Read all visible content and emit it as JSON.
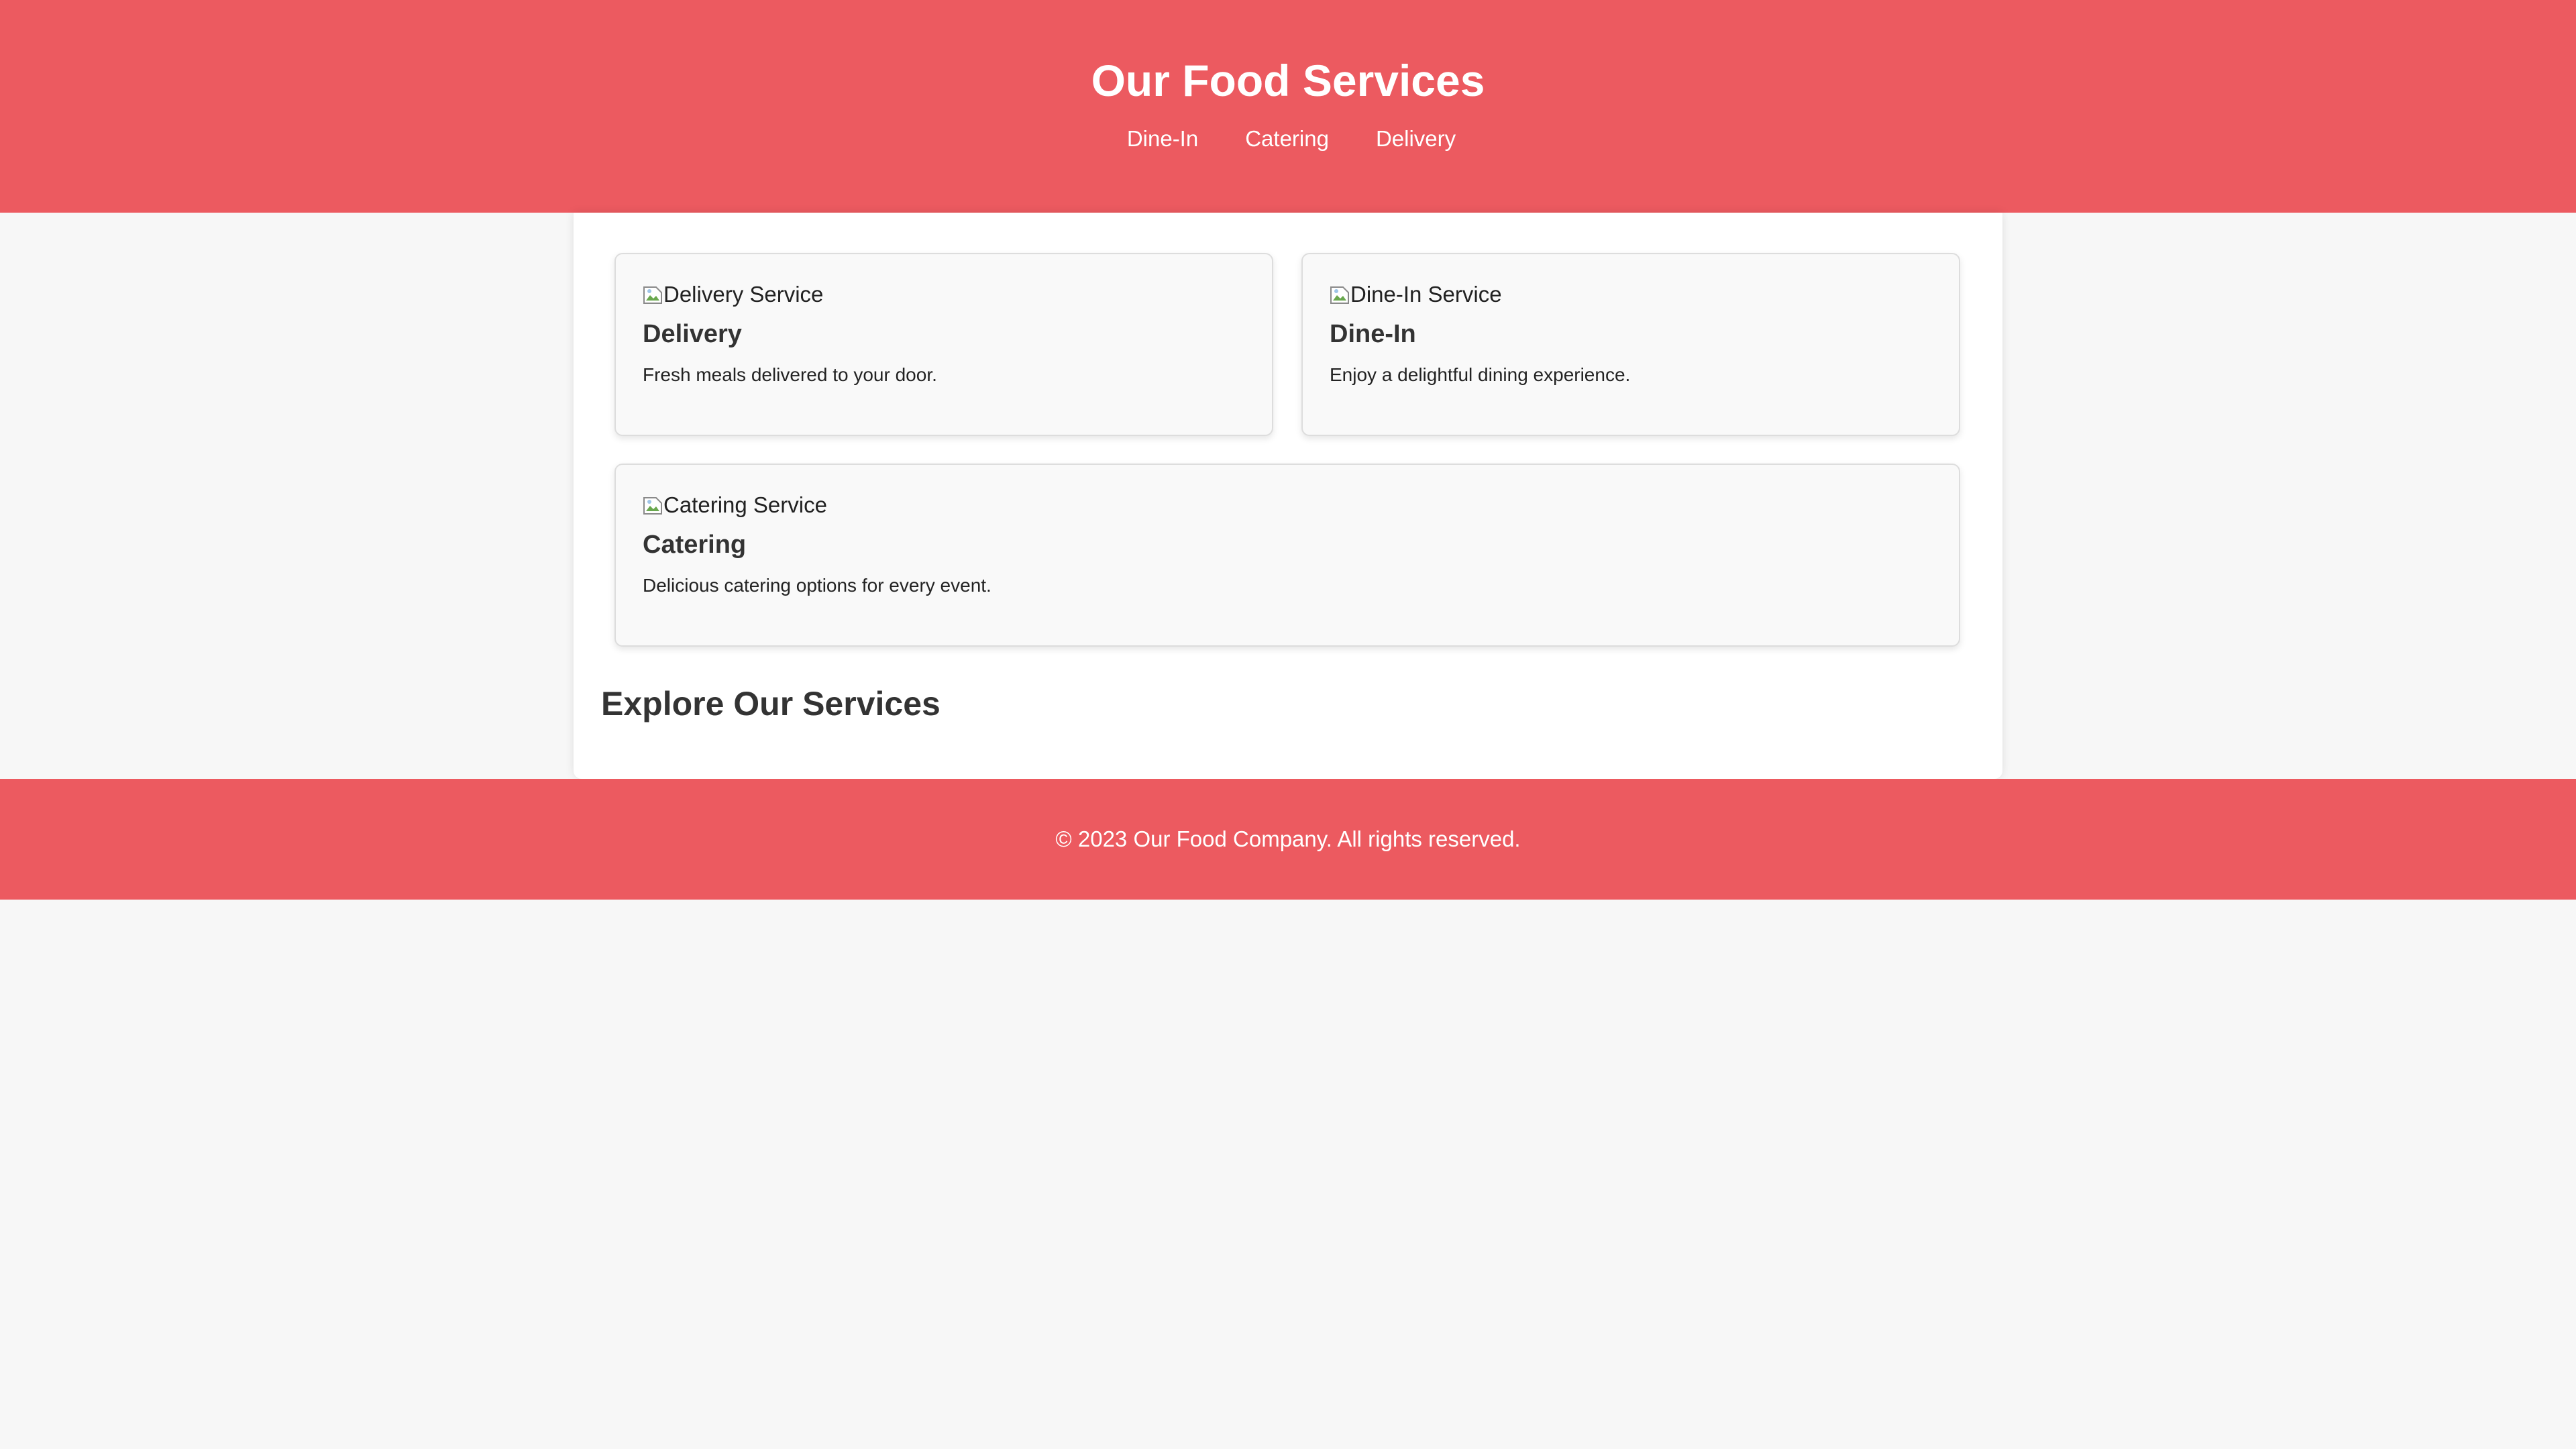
{
  "header": {
    "title": "Our Food Services",
    "nav": [
      "Dine-In",
      "Catering",
      "Delivery"
    ]
  },
  "cards": [
    {
      "img_alt": "Delivery Service",
      "title": "Delivery",
      "description": "Fresh meals delivered to your door."
    },
    {
      "img_alt": "Dine-In Service",
      "title": "Dine-In",
      "description": "Enjoy a delightful dining experience."
    },
    {
      "img_alt": "Catering Service",
      "title": "Catering",
      "description": "Delicious catering options for every event."
    }
  ],
  "section": {
    "title": "Explore Our Services"
  },
  "footer": {
    "text": "© 2023 Our Food Company. All rights reserved."
  },
  "colors": {
    "brand": "#ec5a60",
    "background": "#f7f7f7",
    "card": "#f9f9f9",
    "text": "#333333"
  },
  "icons": {
    "broken_image": "broken-image-icon"
  }
}
